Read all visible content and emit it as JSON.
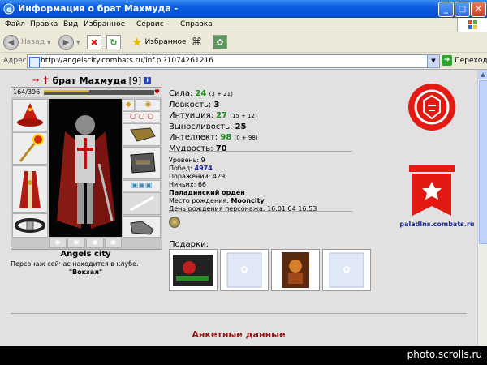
{
  "window": {
    "title": "Информация о брат Махмуда -",
    "minimize_icon": "minimize-icon",
    "maximize_icon": "maximize-icon",
    "close_icon": "close-icon"
  },
  "menu": {
    "items": [
      "Файл",
      "Правка",
      "Вид",
      "Избранное",
      "Сервис",
      "Справка"
    ]
  },
  "toolbar": {
    "back_label": "Назад",
    "favorites_label": "Избранное"
  },
  "address": {
    "label": "Адрес:",
    "url": "http://angelscity.combats.ru/inf.pl?1074261216",
    "go_label": "Переход"
  },
  "character": {
    "name": "брат Махмуда",
    "level": "[9]",
    "hp": "164/396",
    "hp_fraction": 0.41,
    "city": "Angels city",
    "club_text": "Персонаж сейчас находится в клубе.",
    "club_name": "\"Вокзал\""
  },
  "stats": [
    {
      "label": "Сила:",
      "value": "24",
      "extra": "(3 + 21)",
      "green": true
    },
    {
      "label": "Ловкость:",
      "value": "3",
      "extra": "",
      "green": false
    },
    {
      "label": "Интуиция:",
      "value": "27",
      "extra": "(15 + 12)",
      "green": true
    },
    {
      "label": "Выносливость:",
      "value": "25",
      "extra": "",
      "green": false
    },
    {
      "label": "Интеллект:",
      "value": "98",
      "extra": "(0 + 98)",
      "green": true
    },
    {
      "label": "Мудрость:",
      "value": "70",
      "extra": "",
      "green": false
    }
  ],
  "details": {
    "level_label": "Уровень:",
    "level": "9",
    "wins_label": "Побед:",
    "wins": "4974",
    "losses_label": "Поражений:",
    "losses": "429",
    "draws_label": "Ничьих:",
    "draws": "66",
    "order": "Паладинский орден",
    "birthplace_label": "Место рождения:",
    "birthplace": "Mooncity",
    "birthday_label": "День рождения персонажа:",
    "birthday": "16.01.04 16:53"
  },
  "gifts": {
    "title": "Подарки:"
  },
  "clan": {
    "link": "paladins.combats.ru"
  },
  "section": {
    "anketa": "Анкетные данные"
  },
  "watermark": "photo.scrolls.ru"
}
